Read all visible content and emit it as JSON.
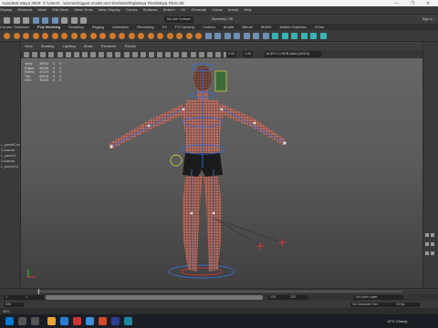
{
  "window": {
    "title": "Autodesk Maya 2020: C:\\Users\\...\\scenes\\rigged model and skin\\Man\\Rig\\Maya Files\\Maya Files.mb",
    "controls": "— ❐ ✕"
  },
  "menu": [
    "Display",
    "Windows",
    "Mesh",
    "Edit Mesh",
    "Mesh Tools",
    "Mesh Display",
    "Curves",
    "Surfaces",
    "Deform",
    "UV",
    "Generate",
    "Cache",
    "Arnold",
    "Help"
  ],
  "status": {
    "live_surface": "No Live Surface",
    "symmetry": "Symmetry: Off",
    "sign_in": "Sign In"
  },
  "shelf_tabs": [
    "Curves / Surfaces",
    "Poly Modeling",
    "Sculpting",
    "Rigging",
    "Animation",
    "Rendering",
    "FX",
    "FX Caching",
    "Custom",
    "Arnold",
    "Bifrost",
    "MASH",
    "Motion Graphics",
    "XGen"
  ],
  "view_menu": [
    "View",
    "Shading",
    "Lighting",
    "Show",
    "Renderer",
    "Panels"
  ],
  "view_fields": {
    "value1": "0.00",
    "value2": "1.00",
    "colorspace": "ACES 1.0 SDR-video (ACES)"
  },
  "hud": [
    {
      "label": "Verts:",
      "a": "39930",
      "b": "0",
      "c": "0"
    },
    {
      "label": "Edges:",
      "a": "80048",
      "b": "0",
      "c": "0"
    },
    {
      "label": "Faces:",
      "a": "40124",
      "b": "0",
      "c": "0"
    },
    {
      "label": "Tris:",
      "a": "80078",
      "b": "0",
      "c": "0"
    },
    {
      "label": "UVs:",
      "a": "46245",
      "b": "0",
      "c": "0"
    }
  ],
  "left_panel": [
    "L_parentCon",
    "Constrain",
    "L_parentC",
    "Constrain",
    "L_parentCo"
  ],
  "timeline": {
    "start": "1",
    "end": "120",
    "range_start": "1",
    "range_end": "120",
    "current": "200"
  },
  "bottom": {
    "character_set": "No Character Set",
    "anim_layer": "No Anim Layer",
    "fps": "24 fps",
    "mel": "MEL"
  },
  "taskbar": {
    "weather": "15°C Cloudy",
    "time": "12:00"
  }
}
